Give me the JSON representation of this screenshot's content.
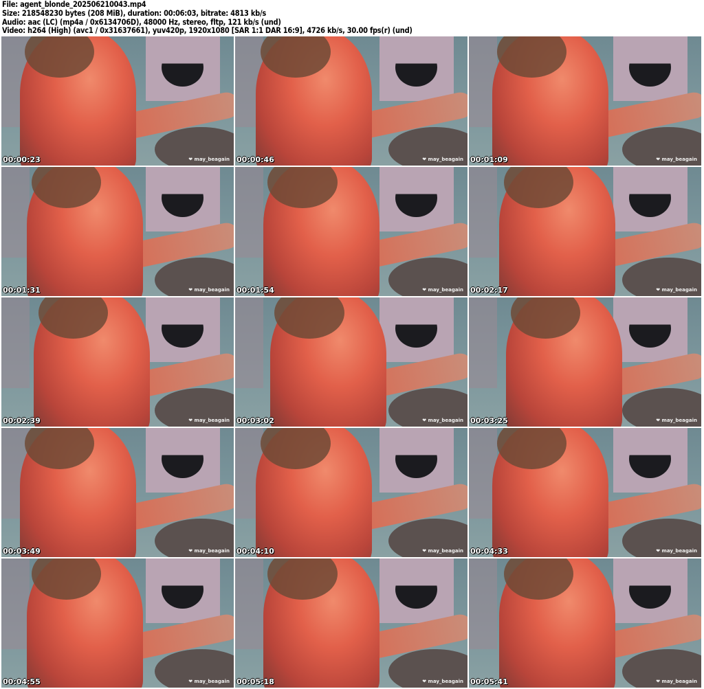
{
  "header": {
    "file": "File: agent_blonde_202506210043.mp4",
    "size": "Size: 218548230 bytes (208 MiB), duration: 00:06:03, bitrate: 4813 kb/s",
    "audio": "Audio: aac (LC) (mp4a / 0x6134706D), 48000 Hz, stereo, fltp, 121 kb/s (und)",
    "video": "Video: h264 (High) (avc1 / 0x31637661), yuv420p, 1920x1080 [SAR 1:1 DAR 16:9], 4726 kb/s, 30.00 fps(r) (und)"
  },
  "watermark": "❤ may_beagain",
  "thumbnails": [
    "00:00:23",
    "00:00:46",
    "00:01:09",
    "00:01:31",
    "00:01:54",
    "00:02:17",
    "00:02:39",
    "00:03:02",
    "00:03:25",
    "00:03:49",
    "00:04:10",
    "00:04:33",
    "00:04:55",
    "00:05:18",
    "00:05:41"
  ]
}
